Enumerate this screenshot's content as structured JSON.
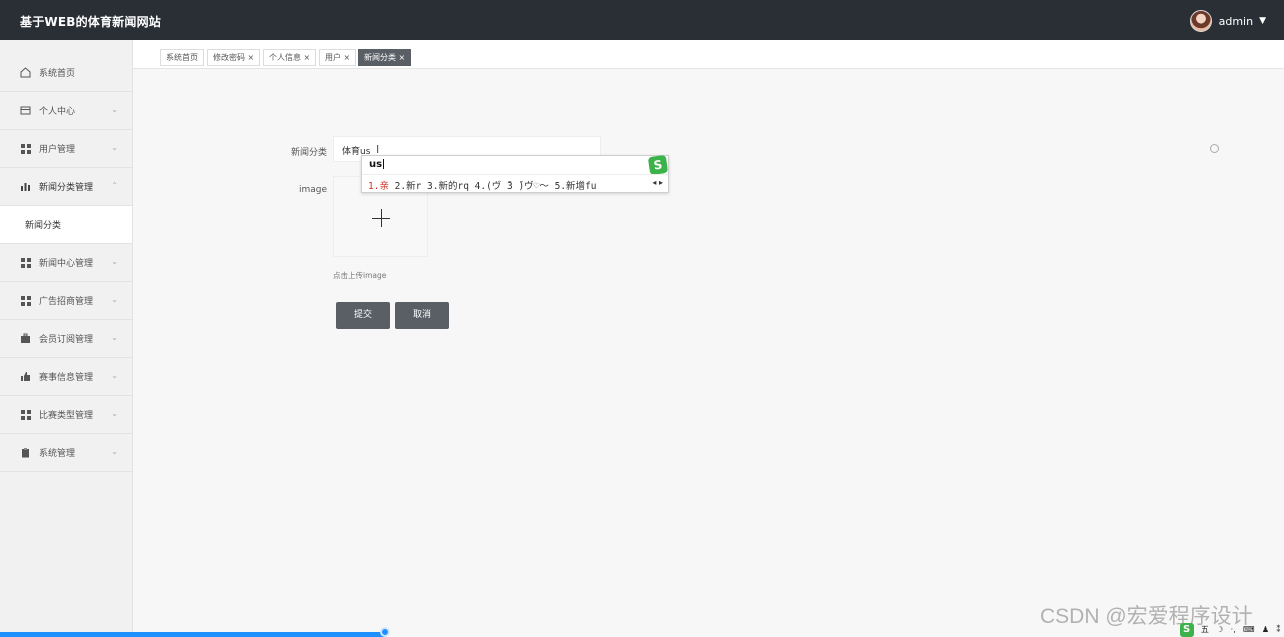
{
  "header": {
    "title": "基于WEB的体育新闻网站",
    "username": "admin",
    "caret": "▼"
  },
  "sidebar": {
    "items": [
      {
        "label": "系统首页",
        "icon": "home-icon"
      },
      {
        "label": "个人中心",
        "icon": "card-icon",
        "chevron": "⌄"
      },
      {
        "label": "用户管理",
        "icon": "grid-icon",
        "chevron": "⌄"
      },
      {
        "label": "新闻分类管理",
        "icon": "bar-chart-icon",
        "chevron": "⌃"
      },
      {
        "label": "新闻分类",
        "sub": true
      },
      {
        "label": "新闻中心管理",
        "icon": "grid-icon",
        "chevron": "⌄"
      },
      {
        "label": "广告招商管理",
        "icon": "grid-icon",
        "chevron": "⌄"
      },
      {
        "label": "会员订阅管理",
        "icon": "briefcase-icon",
        "chevron": "⌄"
      },
      {
        "label": "赛事信息管理",
        "icon": "thumb-icon",
        "chevron": "⌄"
      },
      {
        "label": "比赛类型管理",
        "icon": "grid-icon",
        "chevron": "⌄"
      },
      {
        "label": "系统管理",
        "icon": "clipboard-icon",
        "chevron": "⌄"
      }
    ]
  },
  "tabs": [
    {
      "label": "系统首页"
    },
    {
      "label": "修改密码 ×"
    },
    {
      "label": "个人信息 ×"
    },
    {
      "label": "用户 ×"
    },
    {
      "label": "新闻分类 ×",
      "active": true
    }
  ],
  "form": {
    "category_label": "新闻分类",
    "category_value": "体育us",
    "image_label": "image",
    "upload_hint": "点击上传image",
    "submit_label": "提交",
    "cancel_label": "取消"
  },
  "ime": {
    "composition": "us",
    "first_candidate": "1.亲",
    "other_candidates": " 2.新r 3.新的rq 4.(ヴ ̄3 ̄)ヴ♡～ 5.新增fu",
    "logo": "S",
    "nav": "◂ ▸"
  },
  "watermark": "CSDN @宏爱程序设计",
  "tray": [
    "五",
    "☽",
    "·,",
    "⌨",
    "♟",
    "⁑"
  ],
  "colors": {
    "topbar": "#2a2f36",
    "button": "#5a5f66",
    "ime_green": "#3bb24a",
    "progress": "#1e90ff"
  }
}
